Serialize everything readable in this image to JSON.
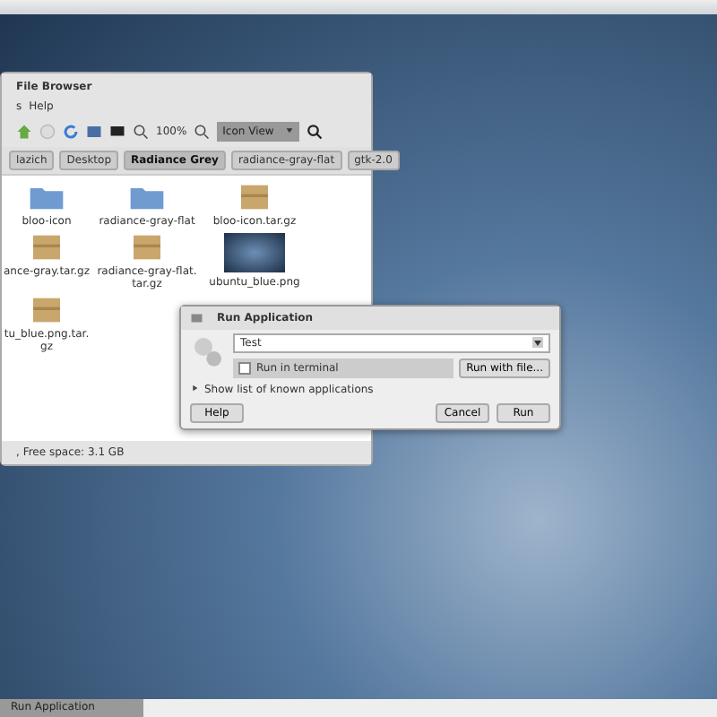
{
  "file_browser": {
    "title": "File Browser",
    "menu": [
      "s",
      "Help"
    ],
    "zoom": "100%",
    "view": "Icon View",
    "path": [
      {
        "label": "lazich",
        "selected": false
      },
      {
        "label": "Desktop",
        "selected": false
      },
      {
        "label": "Radiance Grey",
        "selected": true
      },
      {
        "label": "radiance-gray-flat",
        "selected": false
      },
      {
        "label": "gtk-2.0",
        "selected": false
      }
    ],
    "items": [
      {
        "name": "bloo-icon",
        "kind": "folder"
      },
      {
        "name": "radiance-gray-flat",
        "kind": "folder"
      },
      {
        "name": "bloo-icon.tar.gz",
        "kind": "archive"
      },
      {
        "name": "ance-gray.tar.gz",
        "kind": "archive"
      },
      {
        "name": "radiance-gray-flat.\ntar.gz",
        "kind": "archive"
      },
      {
        "name": "ubuntu_blue.png",
        "kind": "image"
      },
      {
        "name": "tu_blue.png.tar.\ngz",
        "kind": "archive"
      }
    ],
    "status": ", Free space: 3.1 GB"
  },
  "run_dialog": {
    "title": "Run Application",
    "command": "Test",
    "run_in_terminal": {
      "label": "Run in terminal",
      "checked": false
    },
    "run_with_file": "Run with file...",
    "known_apps": {
      "label": "Show list of known applications",
      "expanded": false
    },
    "buttons": [
      "Help",
      "Cancel",
      "Run"
    ]
  },
  "taskbar": [
    {
      "label": "Run Application",
      "selected": true
    }
  ]
}
